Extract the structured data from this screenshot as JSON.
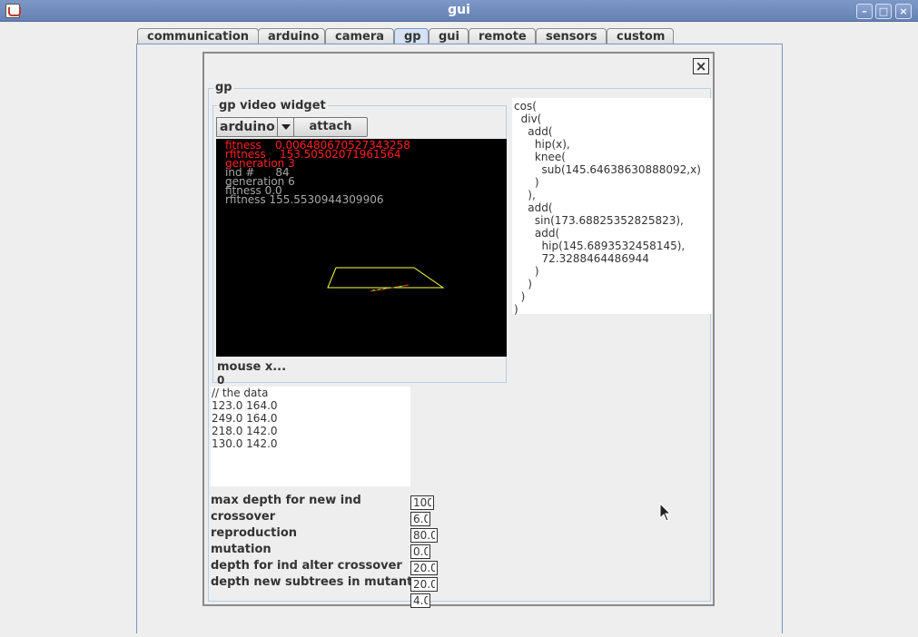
{
  "window": {
    "title": "gui"
  },
  "tabs": [
    {
      "label": "communication"
    },
    {
      "label": "arduino"
    },
    {
      "label": "camera"
    },
    {
      "label": "gp"
    },
    {
      "label": "gui"
    },
    {
      "label": "remote"
    },
    {
      "label": "sensors"
    },
    {
      "label": "custom"
    }
  ],
  "active_tab": "gp",
  "frame": {
    "close_symbol": "×"
  },
  "gp_panel": {
    "title": "gp",
    "video_widget": {
      "title": "gp  video widget",
      "source_selected": "arduino",
      "attach_label": "attach",
      "overlay": {
        "red": [
          "fitness    0.006480670527343258",
          "rfitness    153.50502071961564",
          "generation 3"
        ],
        "gray": [
          "ind #      84",
          "generation 6",
          "fitness 0.0",
          "rfitness 155.5530944309906"
        ]
      },
      "mouse_label": "mouse x...",
      "mouse_value": "0"
    },
    "expression_lines": [
      "cos(",
      "  div(",
      "    add(",
      "      hip(x),",
      "      knee(",
      "        sub(145.64638630888092,x)",
      "      )",
      "    ),",
      "    add(",
      "      sin(173.68825352825823),",
      "      add(",
      "        hip(145.6893532458145),",
      "        72.3288464486944",
      "      )",
      "    )",
      "  )",
      ")"
    ],
    "data_lines": [
      "// the data",
      "123.0 164.0",
      "249.0 164.0",
      "218.0 142.0",
      "130.0 142.0"
    ],
    "params": [
      {
        "label": "max depth for new ind",
        "value": "100"
      },
      {
        "label": "crossover",
        "value": "6.0"
      },
      {
        "label": "reproduction",
        "value": "80.0"
      },
      {
        "label": "mutation",
        "value": "0.0"
      },
      {
        "label": "depth for ind alter crossover",
        "value": "20.0"
      },
      {
        "label": "depth new subtrees in mutant",
        "value": "20.0"
      },
      {
        "label": "",
        "value": "4.0"
      }
    ]
  },
  "colors": {
    "titlebar": "#6d89bb",
    "active_tab": "#d6e2f2",
    "overlay_red": "#ff2020",
    "overlay_gray": "#a8a8a8",
    "shape_line": "#ffff40"
  }
}
